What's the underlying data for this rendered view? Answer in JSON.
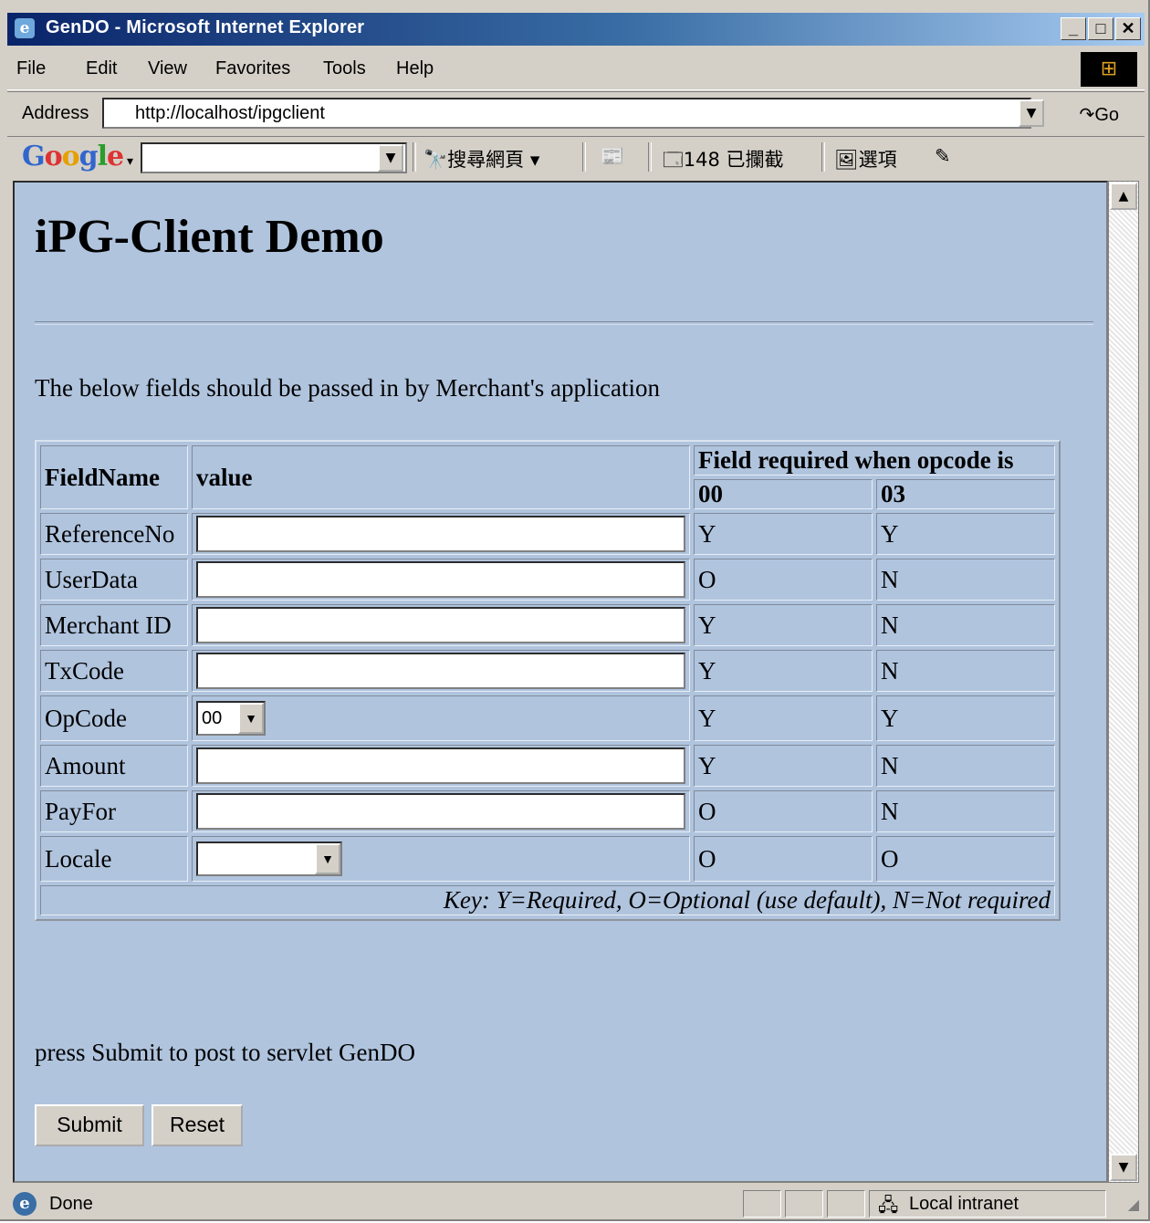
{
  "window": {
    "title": "GenDO - Microsoft Internet Explorer"
  },
  "menu": [
    "File",
    "Edit",
    "View",
    "Favorites",
    "Tools",
    "Help"
  ],
  "address": {
    "label": "Address",
    "url": "http://localhost/ipgclient",
    "go_label": "Go"
  },
  "google_bar": {
    "logo": "Google",
    "search_label": "搜尋網頁",
    "blocked_label": "148 已攔截",
    "options_label": "選項"
  },
  "page": {
    "heading": "iPG-Client Demo",
    "intro": "The below fields should be passed in by Merchant's application",
    "table": {
      "col_fieldname": "FieldName",
      "col_value": "value",
      "col_required": "Field required when opcode is",
      "opcode_cols": [
        "00",
        "03"
      ],
      "rows": [
        {
          "name": "ReferenceNo",
          "type": "text",
          "r00": "Y",
          "r03": "Y"
        },
        {
          "name": "UserData",
          "type": "text",
          "r00": "O",
          "r03": "N"
        },
        {
          "name": "Merchant ID",
          "type": "text",
          "r00": "Y",
          "r03": "N"
        },
        {
          "name": "TxCode",
          "type": "text",
          "r00": "Y",
          "r03": "N"
        },
        {
          "name": "OpCode",
          "type": "select",
          "selected": "00",
          "r00": "Y",
          "r03": "Y"
        },
        {
          "name": "Amount",
          "type": "text",
          "r00": "Y",
          "r03": "N"
        },
        {
          "name": "PayFor",
          "type": "text",
          "r00": "O",
          "r03": "N"
        },
        {
          "name": "Locale",
          "type": "select",
          "selected": "",
          "r00": "O",
          "r03": "O"
        }
      ],
      "key": "Key: Y=Required, O=Optional (use default), N=Not required"
    },
    "press_text": "press Submit to post to servlet GenDO",
    "submit_label": "Submit",
    "reset_label": "Reset"
  },
  "status": {
    "text": "Done",
    "zone": "Local intranet"
  }
}
